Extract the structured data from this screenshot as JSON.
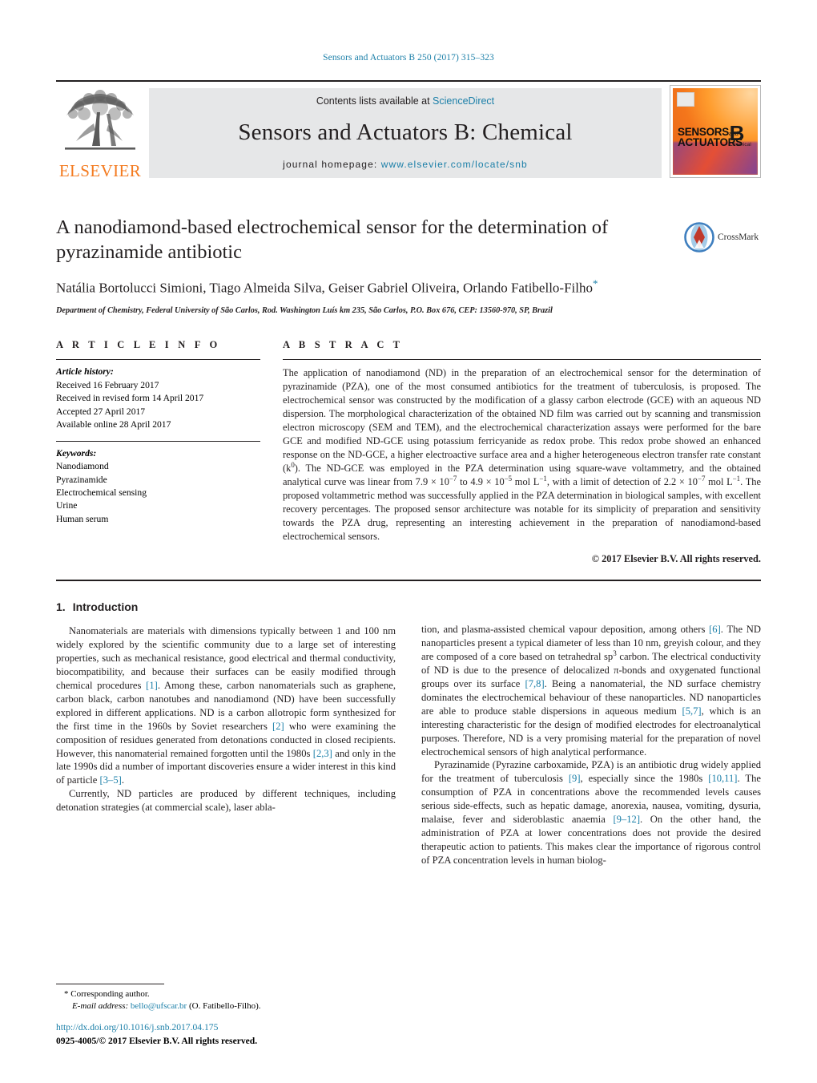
{
  "running_head": "Sensors and Actuators B 250 (2017) 315–323",
  "masthead": {
    "publisher_name": "ELSEVIER",
    "contents_prefix": "Contents lists available at ",
    "contents_link": "ScienceDirect",
    "journal_title": "Sensors and Actuators B: Chemical",
    "homepage_prefix": "journal homepage: ",
    "homepage_url": "www.elsevier.com/locate/snb",
    "cover": {
      "line1": "SENSORS",
      "line1_small": "and",
      "line2": "ACTUATORS",
      "letter": "B",
      "letter_sub": "Chemical"
    }
  },
  "article": {
    "title": "A nanodiamond-based electrochemical sensor for the determination of pyrazinamide antibiotic",
    "authors": "Natália Bortolucci Simioni, Tiago Almeida Silva, Geiser Gabriel Oliveira, Orlando Fatibello-Filho",
    "corresponding_marker": "*",
    "affiliation": "Department of Chemistry, Federal University of São Carlos, Rod. Washington Luís km 235, São Carlos, P.O. Box 676, CEP: 13560-970, SP, Brazil",
    "crossmark_label": "CrossMark"
  },
  "article_info": {
    "heading": "A R T I C L E   I N F O",
    "history_label": "Article history:",
    "history": [
      "Received 16 February 2017",
      "Received in revised form 14 April 2017",
      "Accepted 27 April 2017",
      "Available online 28 April 2017"
    ],
    "keywords_label": "Keywords:",
    "keywords": [
      "Nanodiamond",
      "Pyrazinamide",
      "Electrochemical sensing",
      "Urine",
      "Human serum"
    ]
  },
  "abstract": {
    "heading": "A B S T R A C T",
    "text": "The application of nanodiamond (ND) in the preparation of an electrochemical sensor for the determination of pyrazinamide (PZA), one of the most consumed antibiotics for the treatment of tuberculosis, is proposed. The electrochemical sensor was constructed by the modification of a glassy carbon electrode (GCE) with an aqueous ND dispersion. The morphological characterization of the obtained ND film was carried out by scanning and transmission electron microscopy (SEM and TEM), and the electrochemical characterization assays were performed for the bare GCE and modified ND-GCE using potassium ferricyanide as redox probe. This redox probe showed an enhanced response on the ND-GCE, a higher electroactive surface area and a higher heterogeneous electron transfer rate constant (k0). The ND-GCE was employed in the PZA determination using square-wave voltammetry, and the obtained analytical curve was linear from 7.9 × 10−7 to 4.9 × 10−5 mol L−1, with a limit of detection of 2.2 × 10−7 mol L−1. The proposed voltammetric method was successfully applied in the PZA determination in biological samples, with excellent recovery percentages. The proposed sensor architecture was notable for its simplicity of preparation and sensitivity towards the PZA drug, representing an interesting achievement in the preparation of nanodiamond-based electrochemical sensors.",
    "copyright": "© 2017 Elsevier B.V. All rights reserved."
  },
  "body": {
    "section_number": "1.",
    "section_title": "Introduction",
    "left_paragraphs": [
      "Nanomaterials are materials with dimensions typically between 1 and 100 nm widely explored by the scientific community due to a large set of interesting properties, such as mechanical resistance, good electrical and thermal conductivity, biocompatibility, and because their surfaces can be easily modified through chemical procedures [1]. Among these, carbon nanomaterials such as graphene, carbon black, carbon nanotubes and nanodiamond (ND) have been successfully explored in different applications. ND is a carbon allotropic form synthesized for the first time in the 1960s by Soviet researchers [2] who were examining the composition of residues generated from detonations conducted in closed recipients. However, this nanomaterial remained forgotten until the 1980s [2,3] and only in the late 1990s did a number of important discoveries ensure a wider interest in this kind of particle [3–5].",
      "Currently, ND particles are produced by different techniques, including detonation strategies (at commercial scale), laser abla-"
    ],
    "right_paragraphs": [
      "tion, and plasma-assisted chemical vapour deposition, among others [6]. The ND nanoparticles present a typical diameter of less than 10 nm, greyish colour, and they are composed of a core based on tetrahedral sp3 carbon. The electrical conductivity of ND is due to the presence of delocalized π-bonds and oxygenated functional groups over its surface [7,8]. Being a nanomaterial, the ND surface chemistry dominates the electrochemical behaviour of these nanoparticles. ND nanoparticles are able to produce stable dispersions in aqueous medium [5,7], which is an interesting characteristic for the design of modified electrodes for electroanalytical purposes. Therefore, ND is a very promising material for the preparation of novel electrochemical sensors of high analytical performance.",
      "Pyrazinamide (Pyrazine carboxamide, PZA) is an antibiotic drug widely applied for the treatment of tuberculosis [9], especially since the 1980s [10,11]. The consumption of PZA in concentrations above the recommended levels causes serious side-effects, such as hepatic damage, anorexia, nausea, vomiting, dysuria, malaise, fever and sideroblastic anaemia [9–12]. On the other hand, the administration of PZA at lower concentrations does not provide the desired therapeutic action to patients. This makes clear the importance of rigorous control of PZA concentration levels in human biolog-"
    ]
  },
  "footnote": {
    "corresponding": "Corresponding author.",
    "email_label": "E-mail address:",
    "email": "bello@ufscar.br",
    "email_owner": "(O. Fatibello-Filho)."
  },
  "footer": {
    "doi": "http://dx.doi.org/10.1016/j.snb.2017.04.175",
    "issn_line": "0925-4005/© 2017 Elsevier B.V. All rights reserved."
  },
  "colors": {
    "link": "#1b7fa8",
    "elsevier_orange": "#f47b20",
    "masthead_grey": "#e6e7e8"
  }
}
